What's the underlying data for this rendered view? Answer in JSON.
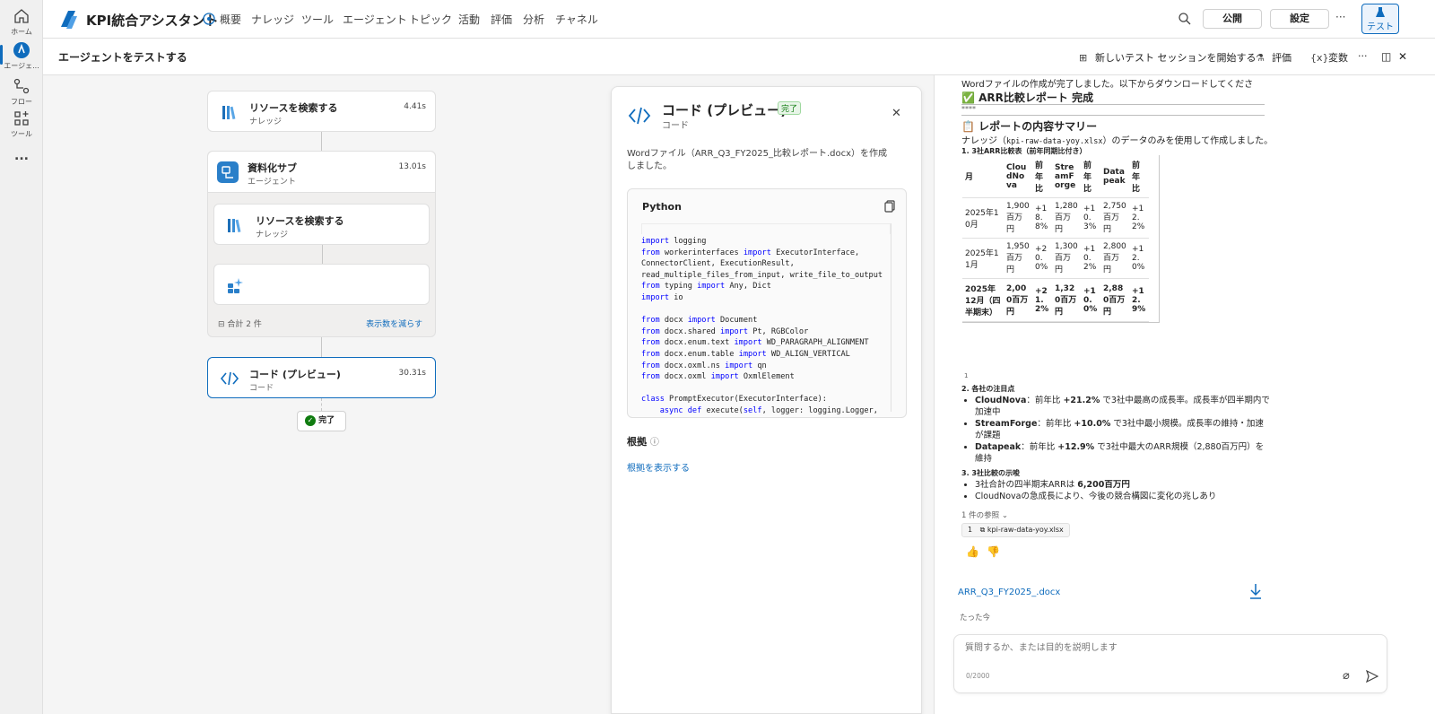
{
  "rail": {
    "home": "ホーム",
    "agent": "エージェ...",
    "flow": "フロー",
    "tool": "ツール",
    "more": "..."
  },
  "topbar": {
    "title": "KPI統合アシスタント",
    "nav": [
      "概要",
      "ナレッジ",
      "ツール",
      "エージェント",
      "トピック",
      "活動",
      "評価",
      "分析",
      "チャネル"
    ],
    "publish_label": "公開",
    "settings_label": "設定",
    "more_label": "···",
    "test_label": "テスト"
  },
  "subheader": {
    "title": "エージェントをテストする",
    "new_session_label": "新しいテスト セッションを開始する",
    "evaluate_label": "評価",
    "variables_label": "変数",
    "more_label": "···"
  },
  "flow": {
    "node1": {
      "title": "リソースを検索する",
      "sub": "ナレッジ",
      "time": "4.41s"
    },
    "node2": {
      "title": "資料化サブ",
      "sub": "エージェント",
      "time": "13.01s"
    },
    "node2_child1": {
      "title": "リソースを検索する",
      "sub": "ナレッジ"
    },
    "total_label": "合計 2 件",
    "show_less_label": "表示数を減らす",
    "node3": {
      "title": "コード (プレビュー)",
      "sub": "コード",
      "time": "30.31s"
    },
    "done_label": "完了"
  },
  "code_panel": {
    "title": "コード (プレビュー)",
    "status": "完了",
    "subtitle": "コード",
    "description": "Wordファイル（ARR_Q3_FY2025_比較レポート.docx）を作成しました。",
    "language": "Python",
    "evidence_label": "根拠",
    "evidence_link": "根拠を表示する",
    "code_lines": [
      [
        "import",
        " logging"
      ],
      [
        "from",
        " workerinterfaces ",
        "import",
        " ExecutorInterface,"
      ],
      [
        "",
        "ConnectorClient, ExecutionResult,"
      ],
      [
        "",
        "read_multiple_files_from_input, write_file_to_output"
      ],
      [
        "from",
        " typing ",
        "import",
        " Any, Dict"
      ],
      [
        "import",
        " io"
      ],
      [
        ""
      ],
      [
        "from",
        " docx ",
        "import",
        " Document"
      ],
      [
        "from",
        " docx.shared ",
        "import",
        " Pt, RGBColor"
      ],
      [
        "from",
        " docx.enum.text ",
        "import",
        " WD_PARAGRAPH_ALIGNMENT"
      ],
      [
        "from",
        " docx.enum.table ",
        "import",
        " WD_ALIGN_VERTICAL"
      ],
      [
        "from",
        " docx.oxml.ns ",
        "import",
        " qn"
      ],
      [
        "from",
        " docx.oxml ",
        "import",
        " OxmlElement"
      ],
      [
        ""
      ],
      [
        "class",
        " PromptExecutor(ExecutorInterface):"
      ],
      [
        "    ",
        "async def",
        " execute(",
        "self",
        ", logger: logging.Logger,"
      ]
    ]
  },
  "chat": {
    "intro": "Wordファイルの作成が完了しました。以下からダウンロードしてください。",
    "heading": "✅ ARR比較レポート 完成",
    "stars": "****",
    "summary_heading": "📋 レポートの内容サマリー",
    "summary_text_pre": "ナレッジ（",
    "summary_file": "kpi-raw-data-yoy.xlsx",
    "summary_text_post": "）のデータのみを使用して作成しました。",
    "section1": "1. 3社ARR比較表（前年同期比付き）",
    "table_headers": [
      "月",
      "CloudNova",
      "前年比",
      "StreamForge",
      "前年比",
      "Datapeak",
      "前年比"
    ],
    "table_rows": [
      [
        "2025年10月",
        "1,900百万円",
        "+18.8%",
        "1,280百万円",
        "+10.3%",
        "2,750百万円",
        "+12.2%"
      ],
      [
        "2025年11月",
        "1,950百万円",
        "+20.0%",
        "1,300百万円",
        "+10.2%",
        "2,800百万円",
        "+12.0%"
      ],
      [
        "2025年12月（四半期末）",
        "2,000百万円",
        "+21.2%",
        "1,320百万円",
        "+10.0%",
        "2,880百万円",
        "+12.9%"
      ]
    ],
    "cite_marker": "1",
    "section2": "2. 各社の注目点",
    "points": [
      {
        "name": "CloudNova",
        "pre": "：前年比 ",
        "value": "+21.2%",
        "post": " で3社中最高の成長率。成長率が四半期内で加速中"
      },
      {
        "name": "StreamForge",
        "pre": "：前年比 ",
        "value": "+10.0%",
        "post": " で3社中最小規模。成長率の維持・加速が課題"
      },
      {
        "name": "Datapeak",
        "pre": "：前年比 ",
        "value": "+12.9%",
        "post": " で3社中最大のARR規模（2,880百万円）を維持"
      }
    ],
    "section3": "3. 3社比較の示唆",
    "insight1_pre": "3社合計の四半期末ARRは ",
    "insight1_value": "6,200百万円",
    "insight2": "CloudNovaの急成長により、今後の競合構図に変化の兆しあり",
    "refs_label": "1 件の参照",
    "ref_num": "1",
    "ref_file": "kpi-raw-data-yoy.xlsx",
    "download_file": "ARR_Q3_FY2025_.docx",
    "timestamp": "たった今",
    "input_placeholder": "質問するか、または目的を説明します",
    "char_count": "0/2000"
  }
}
